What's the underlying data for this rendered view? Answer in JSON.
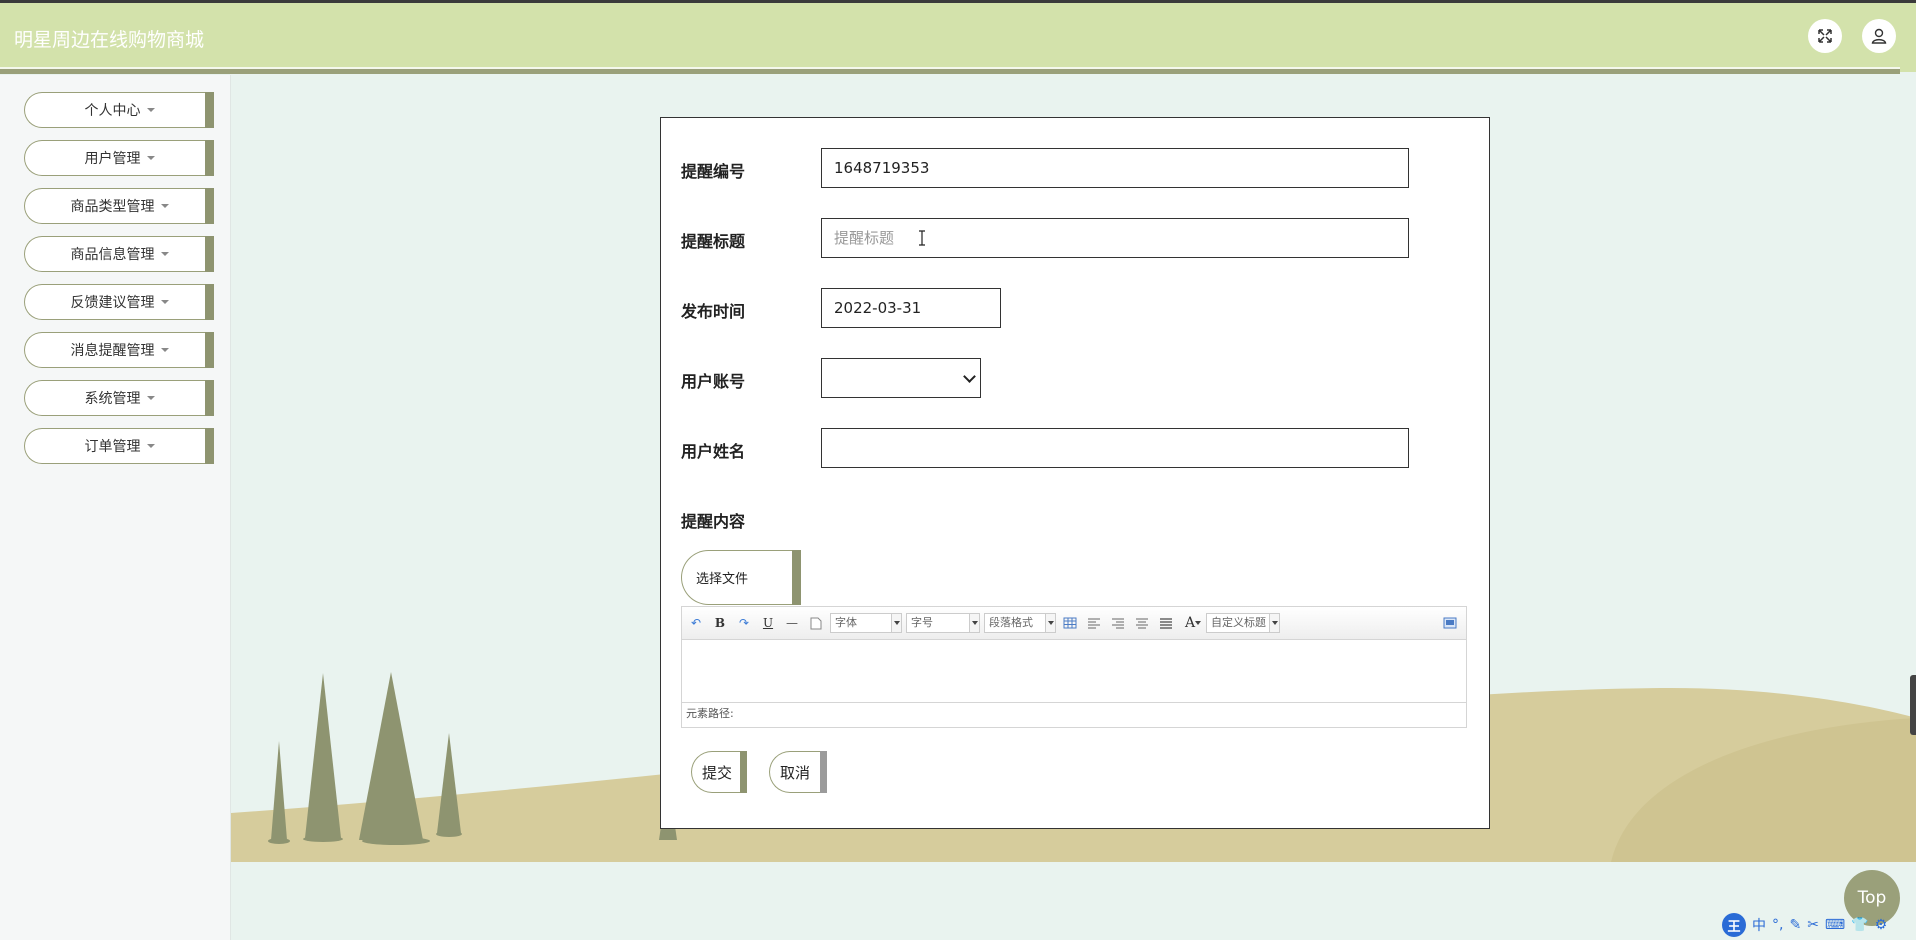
{
  "app": {
    "title": "明星周边在线购物商城"
  },
  "header": {
    "fullscreen_icon": "expand-icon",
    "user_icon": "user-icon"
  },
  "sidebar": {
    "items": [
      {
        "label": "个人中心"
      },
      {
        "label": "用户管理"
      },
      {
        "label": "商品类型管理"
      },
      {
        "label": "商品信息管理"
      },
      {
        "label": "反馈建议管理"
      },
      {
        "label": "消息提醒管理"
      },
      {
        "label": "系统管理"
      },
      {
        "label": "订单管理"
      }
    ]
  },
  "form": {
    "reminder_no": {
      "label": "提醒编号",
      "value": "1648719353"
    },
    "reminder_title": {
      "label": "提醒标题",
      "placeholder": "提醒标题",
      "value": ""
    },
    "publish_time": {
      "label": "发布时间",
      "value": "2022-03-31"
    },
    "user_account": {
      "label": "用户账号",
      "value": ""
    },
    "user_name": {
      "label": "用户姓名",
      "value": ""
    },
    "reminder_content": {
      "label": "提醒内容"
    },
    "file_button": "选择文件",
    "editor": {
      "font_family": "字体",
      "font_size": "字号",
      "paragraph": "段落格式",
      "custom_title": "自定义标题",
      "path_label": "元素路径:"
    },
    "submit_label": "提交",
    "cancel_label": "取消"
  },
  "scroll_top": "Top",
  "ime": {
    "logo": "王",
    "mode": "中"
  },
  "colors": {
    "header_bg": "#d3e2ab",
    "accent": "#8e9470",
    "page_bg": "#e9f3ef",
    "hill": "#d6cc9c",
    "tree": "#8e9470"
  }
}
